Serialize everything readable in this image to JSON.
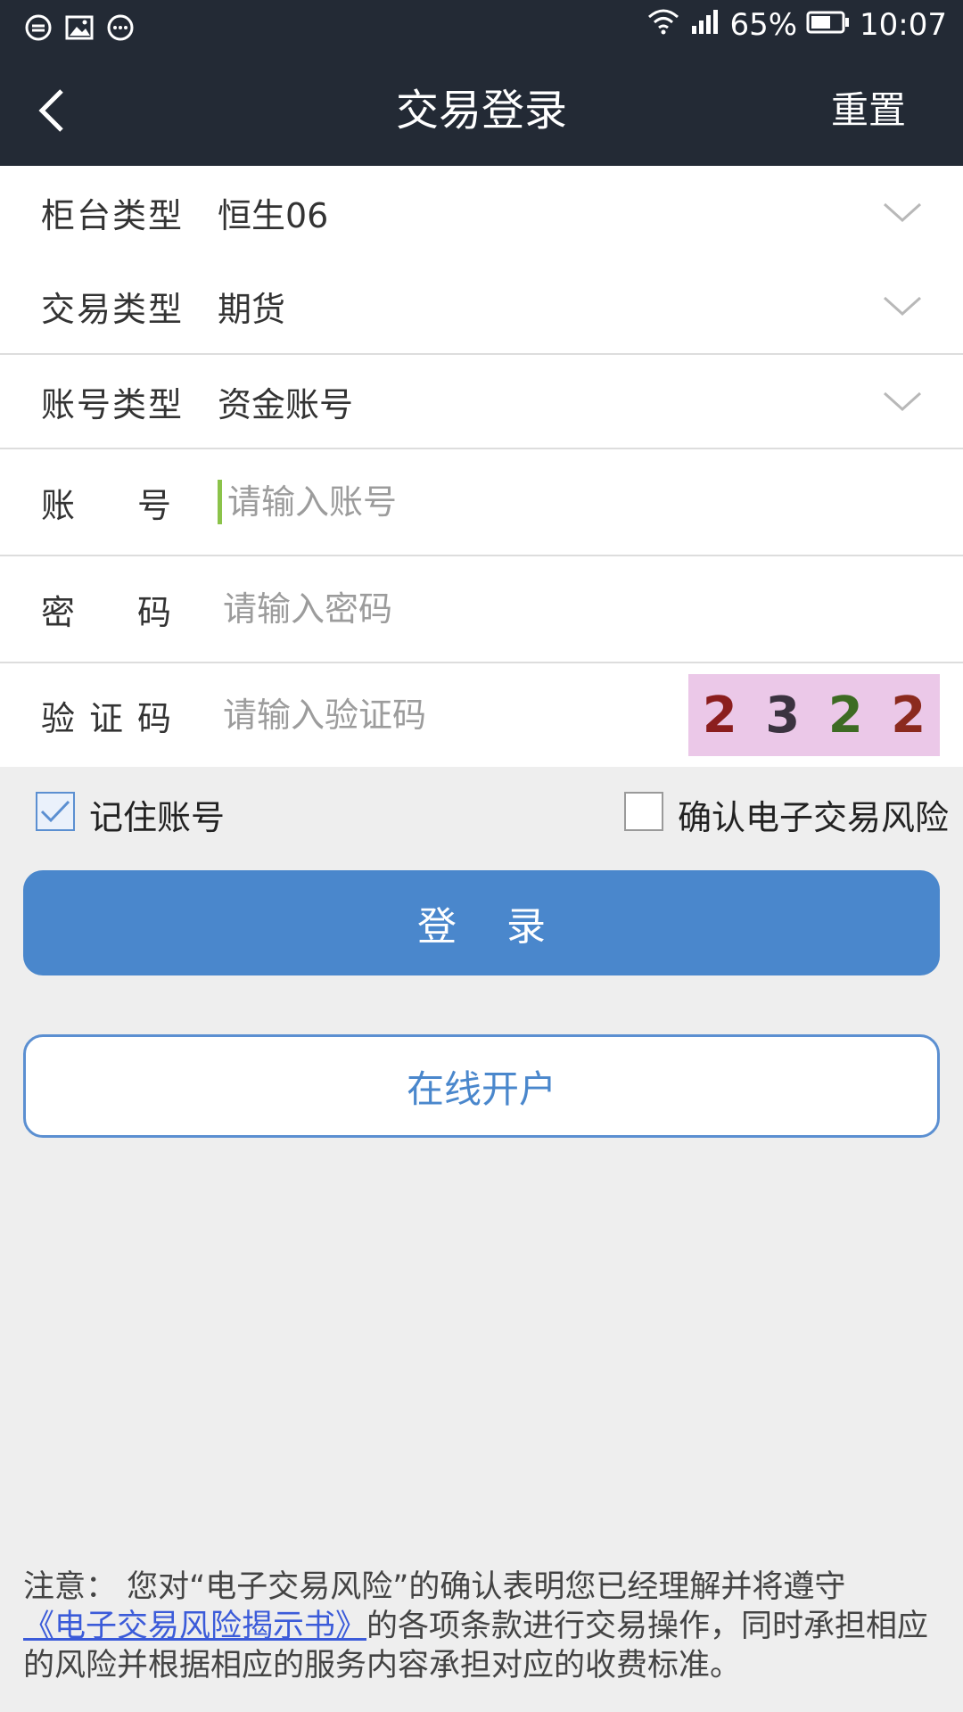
{
  "status_bar": {
    "battery": "65%",
    "time": "10:07",
    "left_icons": [
      "sync-icon",
      "image-icon",
      "chat-icon"
    ],
    "right_icons": [
      "wifi-icon",
      "signal-icon",
      "battery-icon"
    ]
  },
  "header": {
    "title": "交易登录",
    "reset_label": "重置",
    "back_icon": "chevron-left-icon"
  },
  "form": {
    "counter_type": {
      "label": "柜台类型",
      "value": "恒生06"
    },
    "trade_type": {
      "label": "交易类型",
      "value": "期货"
    },
    "account_type": {
      "label": "账号类型",
      "value": "资金账号"
    },
    "account": {
      "label_chars": [
        "账",
        "号"
      ],
      "placeholder": "请输入账号",
      "value": ""
    },
    "password": {
      "label_chars": [
        "密",
        "码"
      ],
      "placeholder": "请输入密码",
      "value": ""
    },
    "captcha": {
      "label_chars": [
        "验",
        "证",
        "码"
      ],
      "placeholder": "请输入验证码",
      "value": "",
      "digits": [
        "2",
        "3",
        "2",
        "2"
      ],
      "digit_colors": [
        "#8b1e1e",
        "#3b3340",
        "#3d6b23",
        "#8b2a1e"
      ],
      "background": "#ebc8e8"
    }
  },
  "options": {
    "remember_account": {
      "label": "记住账号",
      "checked": true
    },
    "confirm_risk": {
      "label": "确认电子交易风险",
      "checked": false
    }
  },
  "buttons": {
    "login": "登    录",
    "open_account": "在线开户"
  },
  "notice": {
    "prefix": "注意： 您对“电子交易风险”的确认表明您已经理解并将遵守",
    "link": "《电子交易风险揭示书》",
    "suffix": "的各项条款进行交易操作，同时承担相应的风险并根据相应的服务内容承担对应的收费标准。"
  },
  "colors": {
    "header_bg": "#232a35",
    "accent": "#4a87cc",
    "page_bg": "#eeeeee",
    "cursor": "#8bc34a"
  }
}
